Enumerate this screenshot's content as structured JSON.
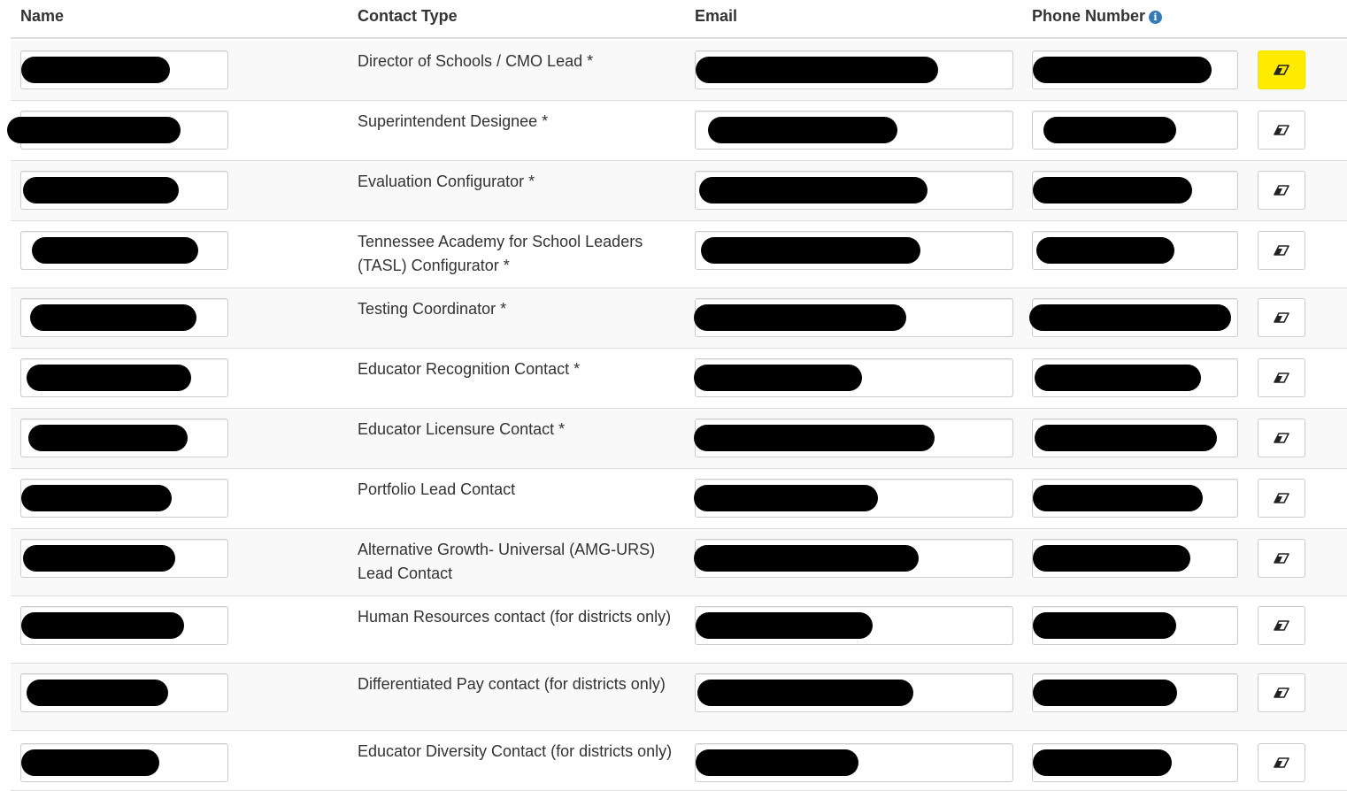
{
  "table": {
    "headers": {
      "name": "Name",
      "contact_type": "Contact Type",
      "email": "Email",
      "phone": "Phone Number"
    },
    "info_icon_glyph": "i",
    "rows": [
      {
        "contact_type": "Director of Schools / CMO Lead *",
        "highlighted": true
      },
      {
        "contact_type": "Superintendent Designee *"
      },
      {
        "contact_type": "Evaluation Configurator *"
      },
      {
        "contact_type": "Tennessee Academy for School Leaders (TASL) Configurator *"
      },
      {
        "contact_type": "Testing Coordinator *"
      },
      {
        "contact_type": "Educator Recognition Contact *"
      },
      {
        "contact_type": "Educator Licensure Contact *"
      },
      {
        "contact_type": "Portfolio Lead Contact"
      },
      {
        "contact_type": "Alternative Growth- Universal (AMG-URS) Lead Contact"
      },
      {
        "contact_type": "Human Resources contact (for districts only)"
      },
      {
        "contact_type": "Differentiated Pay contact (for districts only)"
      },
      {
        "contact_type": "Educator Diversity Contact (for districts only)"
      }
    ],
    "row_action_icon": "eraser-icon"
  },
  "colors": {
    "header_border": "#dddddd",
    "stripe": "#f9f9f9",
    "highlight": "#ffeb00",
    "info_icon": "#337ab7",
    "redaction": "#000000"
  }
}
